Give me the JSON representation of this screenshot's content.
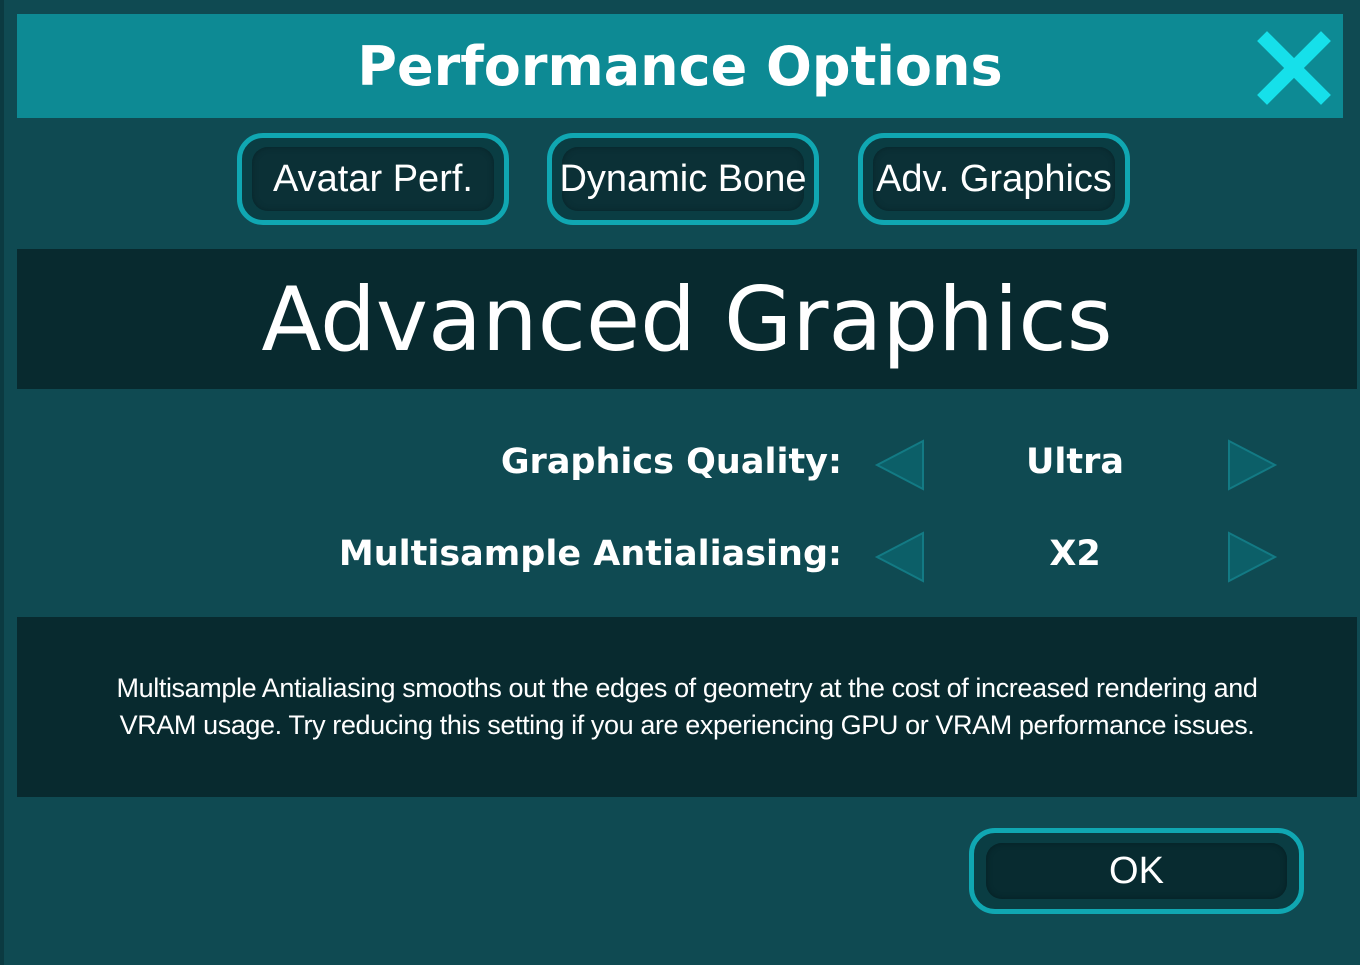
{
  "window": {
    "title": "Performance Options"
  },
  "tabs": [
    {
      "label": "Avatar Perf."
    },
    {
      "label": "Dynamic Bone"
    },
    {
      "label": "Adv. Graphics"
    }
  ],
  "section": {
    "title": "Advanced Graphics"
  },
  "settings": [
    {
      "label": "Graphics Quality:",
      "value": "Ultra"
    },
    {
      "label": "Multisample Antialiasing:",
      "value": "X2"
    }
  ],
  "description": {
    "text": "Multisample Antialiasing smooths out the edges of geometry at the cost of increased rendering and VRAM usage. Try reducing this setting if you are experiencing GPU or VRAM performance issues."
  },
  "footer": {
    "ok_label": "OK"
  },
  "icons": {
    "close": "close-icon",
    "prev": "arrow-left-icon",
    "next": "arrow-right-icon"
  },
  "colors": {
    "titlebar": "#0d8a94",
    "accent": "#10a7b2",
    "close": "#16e0ea",
    "panel": "#0f4a52",
    "dark_panel": "#082a2f"
  }
}
